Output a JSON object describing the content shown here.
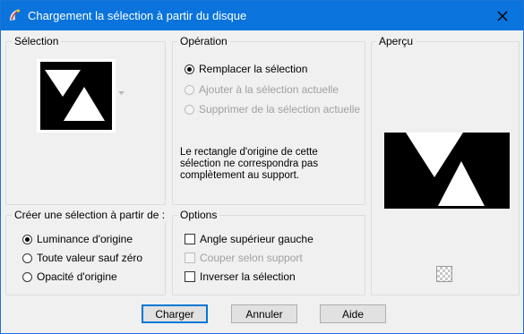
{
  "window": {
    "title": "Chargement la sélection à partir du disque",
    "accent": "#0a74dc"
  },
  "selection": {
    "label": "Sélection"
  },
  "operation": {
    "label": "Opération",
    "options": [
      {
        "label": "Remplacer la sélection",
        "checked": true,
        "enabled": true
      },
      {
        "label": "Ajouter à la sélection actuelle",
        "checked": false,
        "enabled": false
      },
      {
        "label": "Supprimer de la sélection actuelle",
        "checked": false,
        "enabled": false
      }
    ],
    "note_lines": [
      "Le rectangle d'origine de cette",
      "sélection ne correspondra pas",
      "complètement au support."
    ]
  },
  "preview": {
    "label": "Aperçu",
    "checker_icon": "checkerboard-icon"
  },
  "create_from": {
    "label": "Créer une sélection à partir de :",
    "options": [
      {
        "label": "Luminance d'origine",
        "checked": true
      },
      {
        "label": "Toute valeur sauf zéro",
        "checked": false
      },
      {
        "label": "Opacité d'origine",
        "checked": false
      }
    ]
  },
  "options": {
    "label": "Options",
    "items": [
      {
        "label": "Angle supérieur gauche",
        "checked": false,
        "enabled": true
      },
      {
        "label": "Couper selon support",
        "checked": false,
        "enabled": false
      },
      {
        "label": "Inverser la sélection",
        "checked": false,
        "enabled": true
      }
    ]
  },
  "buttons": {
    "load": "Charger",
    "cancel": "Annuler",
    "help": "Aide"
  }
}
